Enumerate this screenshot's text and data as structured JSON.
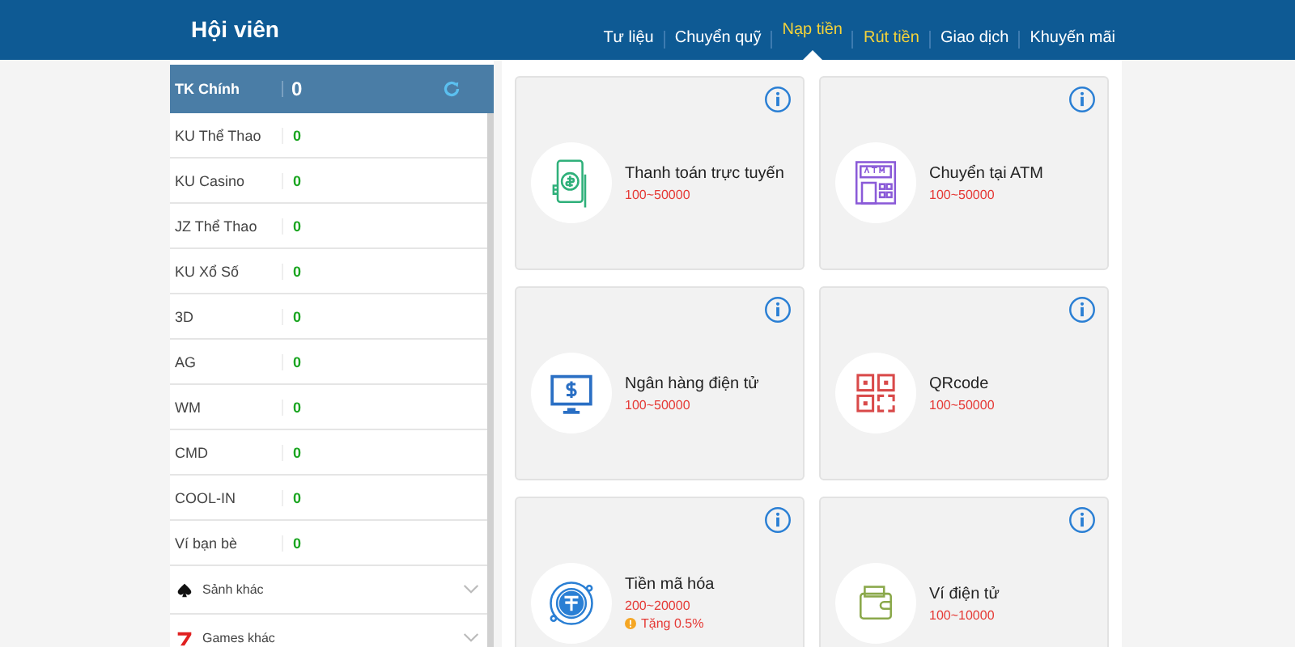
{
  "header": {
    "title": "Hội viên"
  },
  "nav": [
    {
      "label": "Tư liệu",
      "selected": false,
      "highlighted": false
    },
    {
      "label": "Chuyển quỹ",
      "selected": false,
      "highlighted": false
    },
    {
      "label": "Nạp tiền",
      "selected": true,
      "highlighted": true
    },
    {
      "label": "Rút tiền",
      "selected": false,
      "highlighted": true
    },
    {
      "label": "Giao dịch",
      "selected": false,
      "highlighted": false
    },
    {
      "label": "Khuyến mãi",
      "selected": false,
      "highlighted": false
    }
  ],
  "sidebar": {
    "main": {
      "label": "TK Chính",
      "balance": "0"
    },
    "wallets": [
      {
        "name": "KU Thể Thao",
        "balance": "0"
      },
      {
        "name": "KU Casino",
        "balance": "0"
      },
      {
        "name": "JZ Thể Thao",
        "balance": "0"
      },
      {
        "name": "KU Xổ Số",
        "balance": "0"
      },
      {
        "name": "3D",
        "balance": "0"
      },
      {
        "name": "AG",
        "balance": "0"
      },
      {
        "name": "WM",
        "balance": "0"
      },
      {
        "name": "CMD",
        "balance": "0"
      },
      {
        "name": "COOL-IN",
        "balance": "0"
      },
      {
        "name": "Ví bạn bè",
        "balance": "0"
      }
    ],
    "groups": [
      {
        "label": "Sảnh khác",
        "kind": "spade",
        "expanded": false
      },
      {
        "label": "Games khác",
        "kind": "seven",
        "expanded": false
      }
    ]
  },
  "methods": [
    {
      "kind": "phone",
      "title": "Thanh toán trực tuyến",
      "range": "100~50000"
    },
    {
      "kind": "atm",
      "title": "Chuyển tại ATM",
      "range": "100~50000"
    },
    {
      "kind": "monitor",
      "title": "Ngân hàng điện tử",
      "range": "100~50000"
    },
    {
      "kind": "qr",
      "title": "QRcode",
      "range": "100~50000"
    },
    {
      "kind": "crypto",
      "title": "Tiền mã hóa",
      "range": "200~20000",
      "bonus": "Tặng 0.5%"
    },
    {
      "kind": "wallet",
      "title": "Ví điện tử",
      "range": "100~10000"
    }
  ]
}
